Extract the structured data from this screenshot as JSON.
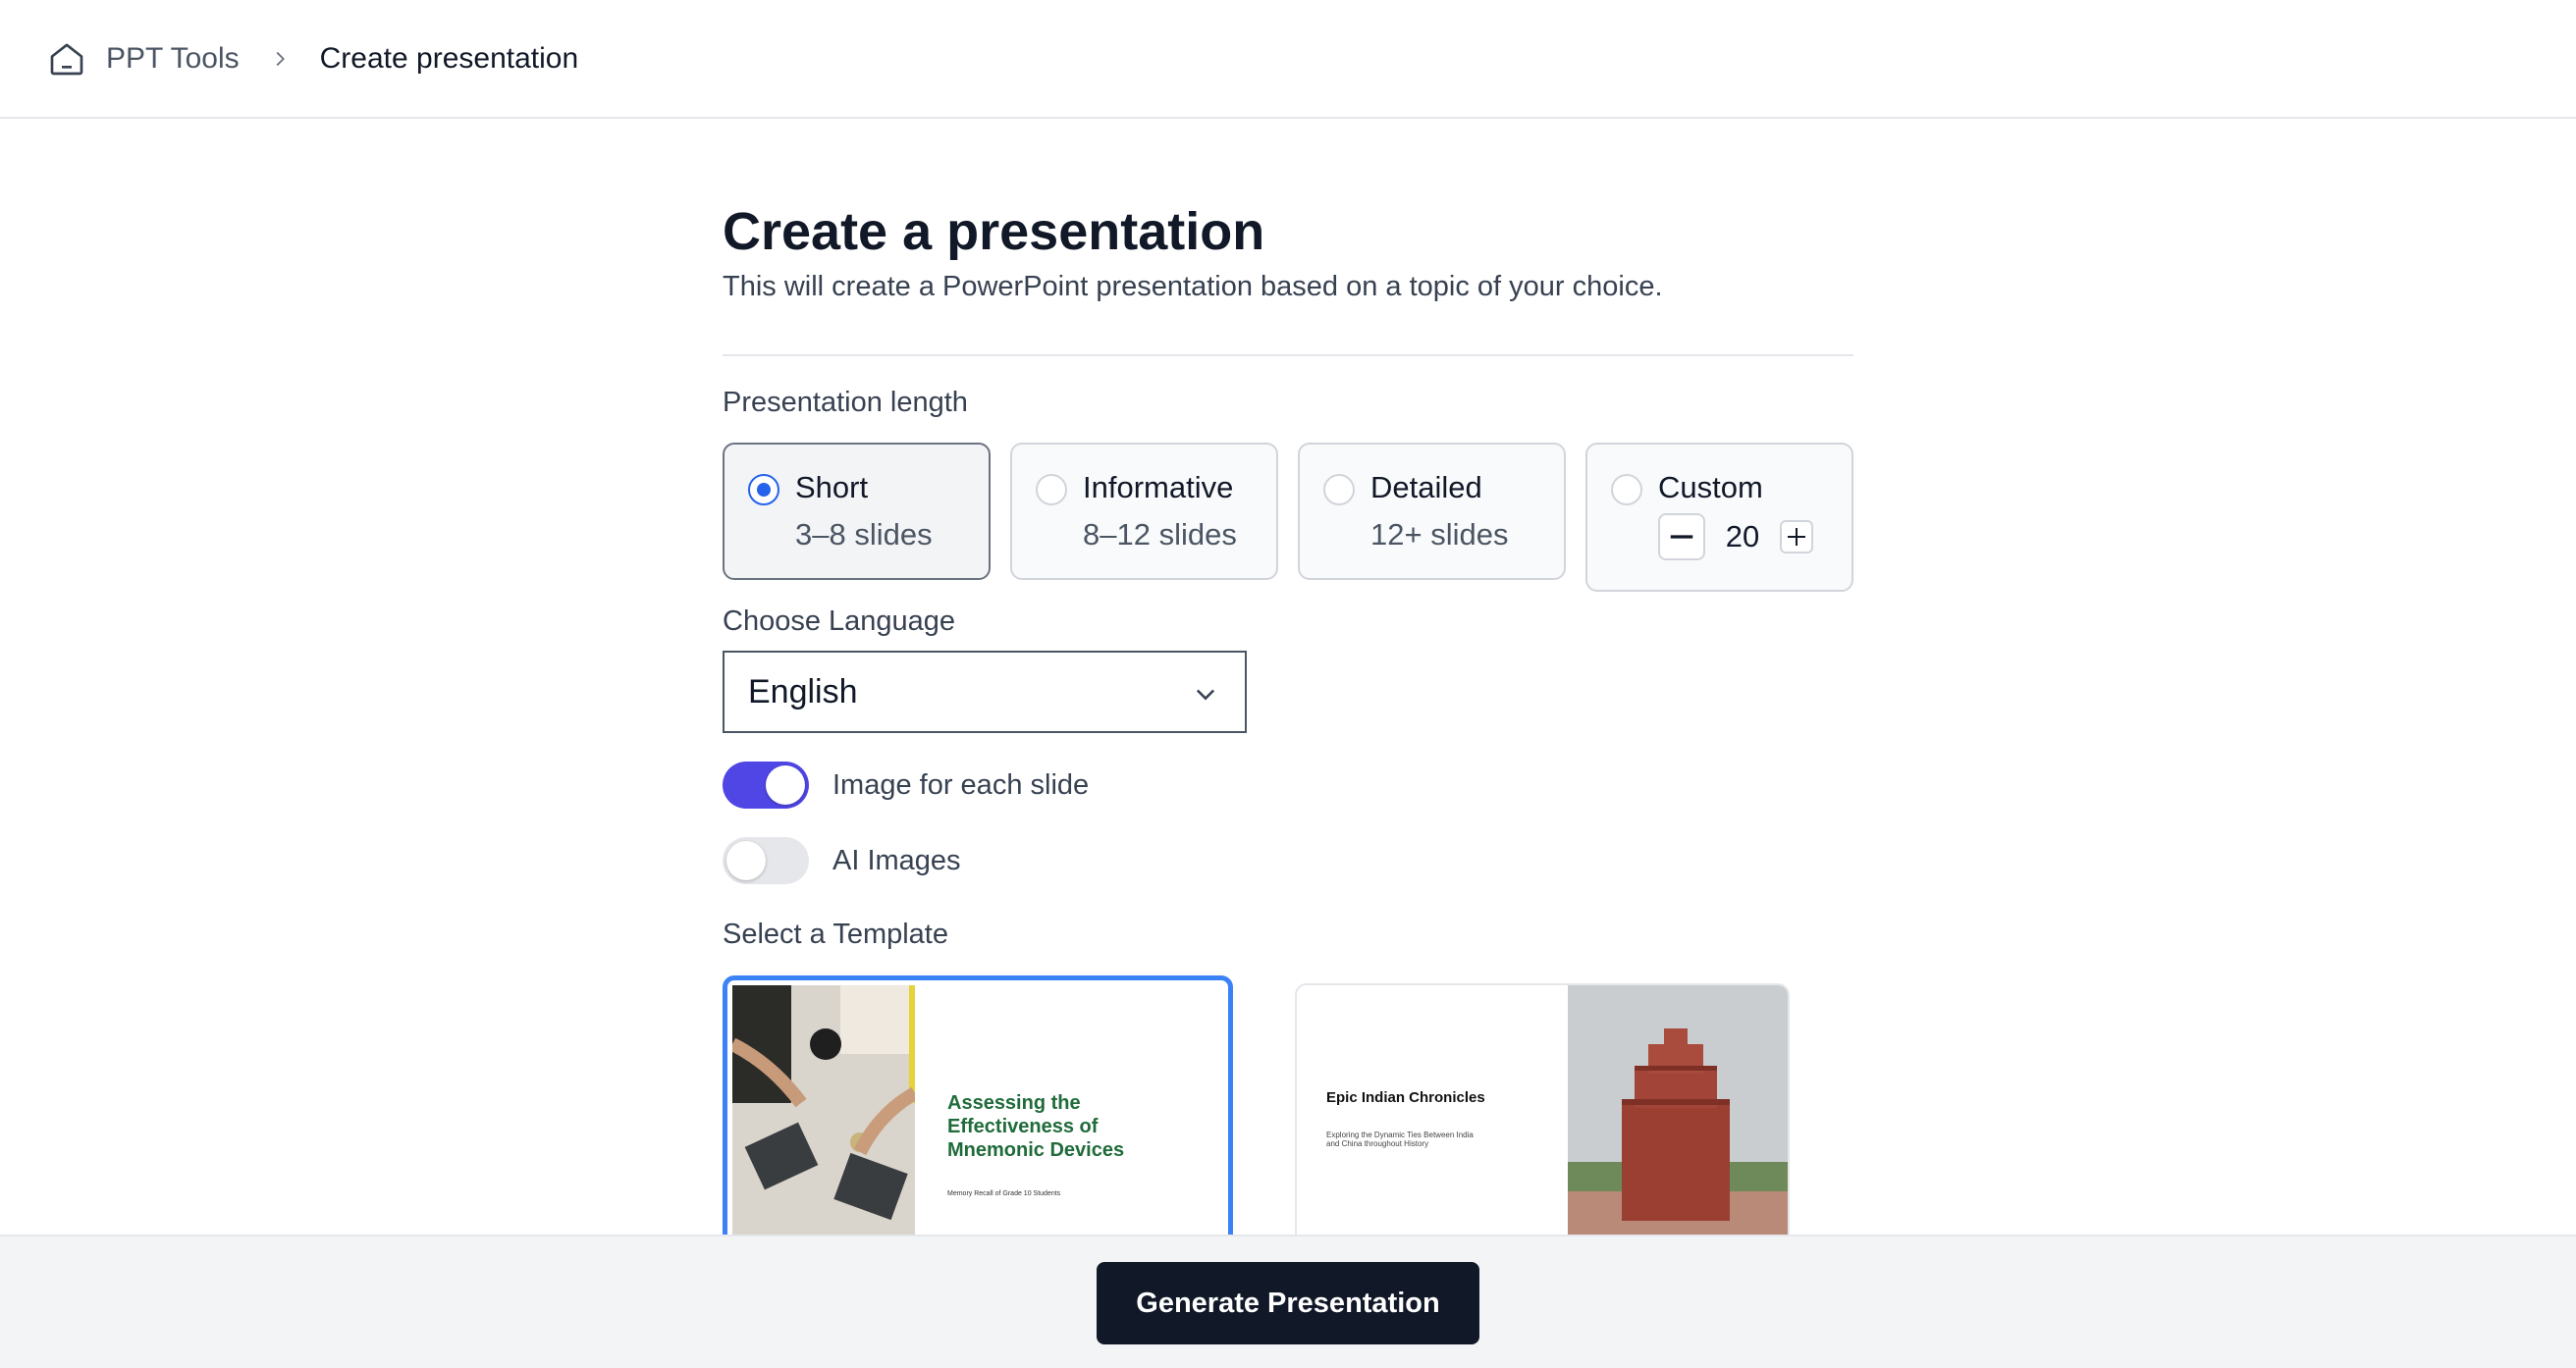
{
  "breadcrumb": {
    "home_icon": "home-icon",
    "root": "PPT Tools",
    "current": "Create presentation"
  },
  "page": {
    "title": "Create a presentation",
    "subtitle": "This will create a PowerPoint presentation based on a topic of your choice."
  },
  "length": {
    "label": "Presentation length",
    "options": [
      {
        "title": "Short",
        "sub": "3–8 slides",
        "selected": true
      },
      {
        "title": "Informative",
        "sub": "8–12 slides",
        "selected": false
      },
      {
        "title": "Detailed",
        "sub": "12+ slides",
        "selected": false
      },
      {
        "title": "Custom",
        "value": "20",
        "selected": false
      }
    ]
  },
  "language": {
    "label": "Choose Language",
    "value": "English"
  },
  "toggles": {
    "image_each_slide": {
      "label": "Image for each slide",
      "on": true
    },
    "ai_images": {
      "label": "AI Images",
      "on": false
    }
  },
  "templates": {
    "label": "Select a Template",
    "items": [
      {
        "title": "Assessing the Effectiveness of Mnemonic Devices",
        "sub": "Memory Recall of Grade 10 Students",
        "selected": true
      },
      {
        "title": "Epic Indian Chronicles",
        "sub": "Exploring the Dynamic Ties Between India and China throughout History",
        "selected": false
      }
    ]
  },
  "footer": {
    "generate_label": "Generate Presentation"
  },
  "colors": {
    "accent": "#4f46e5",
    "selected_border": "#3b82f6",
    "button_bg": "#111827"
  }
}
